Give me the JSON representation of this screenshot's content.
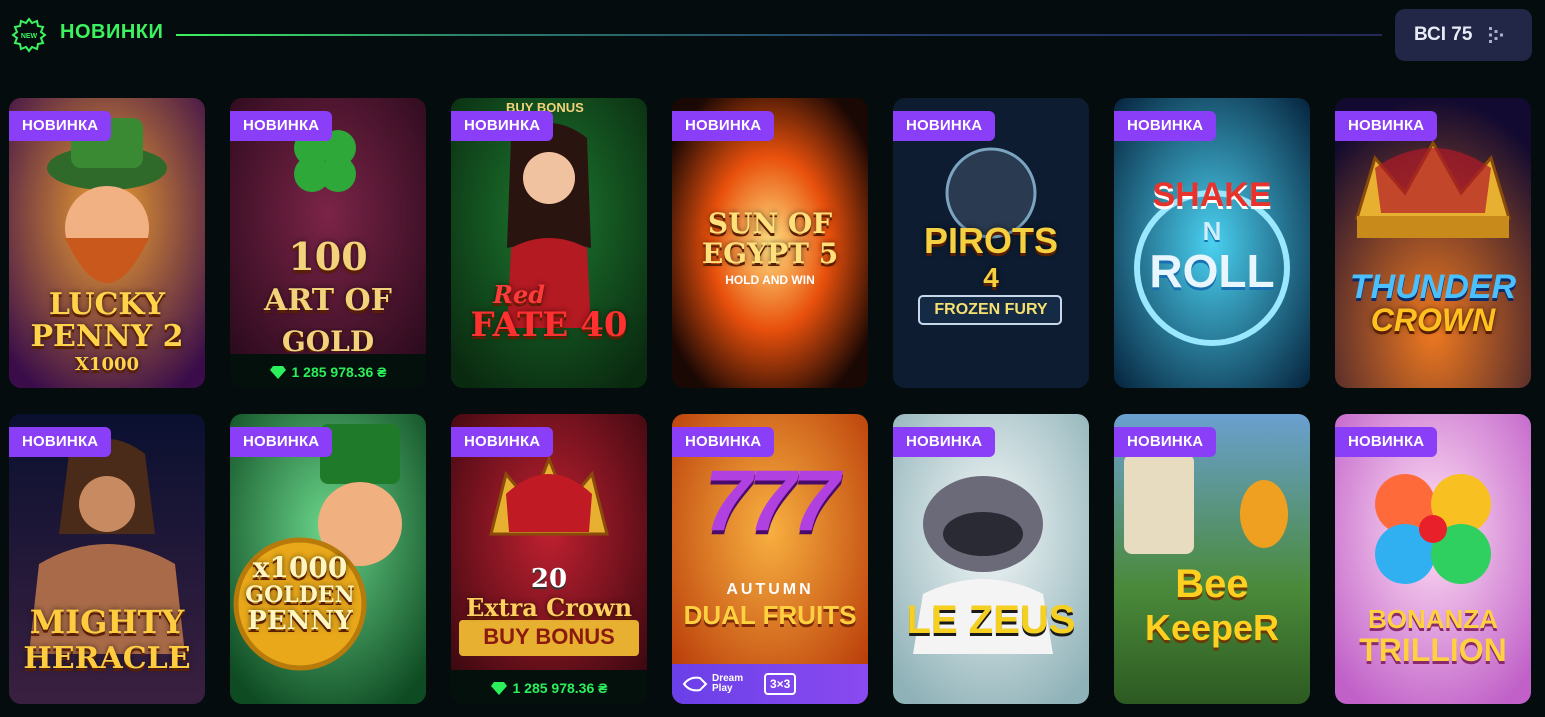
{
  "header": {
    "icon_text": "NEW",
    "title": "НОВИНКИ",
    "all_button": "ВСІ 75"
  },
  "badge_label": "НОВИНКА",
  "games": [
    {
      "id": "lucky-penny-2",
      "line1": "LUCKY",
      "line2": "PENNY 2",
      "line3": "X1000",
      "colors": [
        "#3a0d4a",
        "#d8572a"
      ]
    },
    {
      "id": "100-art-of-gold",
      "line1": "100",
      "line2": "ART OF",
      "line3": "GOLD",
      "jackpot": "1 285 978.36 ₴",
      "colors": [
        "#2a0a1c",
        "#6b1d3d"
      ]
    },
    {
      "id": "red-fate-40",
      "top_tag": "BUY BONUS",
      "line1": "Red",
      "line2": "FATE 40",
      "line3": "",
      "colors": [
        "#0c3b16",
        "#145c25"
      ]
    },
    {
      "id": "sun-of-egypt-5",
      "line1": "SUN OF",
      "line2": "EGYPT 5",
      "line3": "HOLD AND WIN",
      "colors": [
        "#b52a08",
        "#f2a318"
      ]
    },
    {
      "id": "pirots-4",
      "line1": "PIROTS",
      "line2": "4",
      "line3": "FROZEN FURY",
      "colors": [
        "#0a1628",
        "#162a45"
      ]
    },
    {
      "id": "shake-n-roll",
      "line1": "SHAKE",
      "line2": "N",
      "line3": "ROLL",
      "colors": [
        "#0a3a62",
        "#1890b8"
      ]
    },
    {
      "id": "thunder-crown",
      "line1": "THUNDER",
      "line2": "CROWN",
      "line3": "",
      "colors": [
        "#1a0f3a",
        "#d0501a"
      ]
    },
    {
      "id": "mighty-heracle",
      "line1": "MIGHTY",
      "line2": "HERACLE",
      "line3": "",
      "colors": [
        "#0c1432",
        "#3a2a4a"
      ]
    },
    {
      "id": "1000-golden-penny",
      "line1": "x1000",
      "line2": "GOLDEN",
      "line3": "PENNY",
      "colors": [
        "#1e6a3a",
        "#3fb46a"
      ]
    },
    {
      "id": "extra-crown",
      "line1": "20",
      "line2": "Extra Crown",
      "line3": "BUY BONUS",
      "jackpot": "1 285 978.36 ₴",
      "colors": [
        "#4a0a12",
        "#a01c24"
      ]
    },
    {
      "id": "autumn-dual-fruits",
      "line1": "777",
      "line2": "AUTUMN",
      "line3": "DUAL FRUITS",
      "provider": "Dream Play",
      "grid": "3×3",
      "colors": [
        "#d24a0c",
        "#f1a23a"
      ]
    },
    {
      "id": "le-zeus",
      "line1": "LE ZEUS",
      "line2": "",
      "line3": "",
      "colors": [
        "#d8e8e8",
        "#8fb2b8"
      ]
    },
    {
      "id": "bee-keeper",
      "line1": "Bee",
      "line2": "KeepeR",
      "line3": "",
      "colors": [
        "#2d6a3a",
        "#7fb04a"
      ]
    },
    {
      "id": "bonanza-trillion",
      "line1": "BONANZA",
      "line2": "TRILLION",
      "line3": "",
      "colors": [
        "#d87ad8",
        "#f2b4e8"
      ]
    }
  ]
}
